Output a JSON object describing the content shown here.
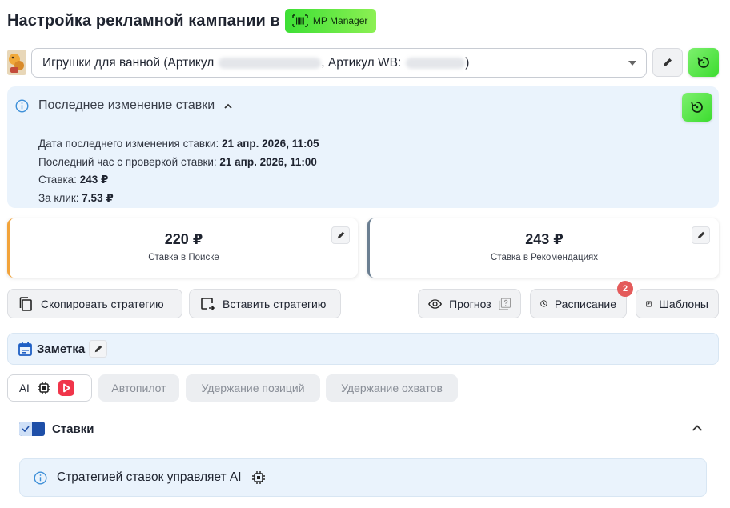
{
  "header": {
    "title": "Настройка рекламной кампании в",
    "brand_label": "MP Manager",
    "brand_color": "#3ddf35"
  },
  "product": {
    "name_prefix": "Игрушки для ванной (Артикул",
    "article_wb_label": ", Артикул WB:",
    "suffix": ")"
  },
  "last_change": {
    "title": "Последнее изменение ставки",
    "rows": [
      {
        "label": "Дата последнего изменения ставки: ",
        "value": "21 апр. 2026, 11:05"
      },
      {
        "label": "Последний час с проверкой ставки: ",
        "value": "21 апр. 2026, 11:00"
      },
      {
        "label": "Ставка: ",
        "value": "243 ₽"
      },
      {
        "label": "За клик: ",
        "value": "7.53 ₽"
      }
    ]
  },
  "bids": {
    "search": {
      "amount": "220 ₽",
      "caption": "Ставка в Поиске",
      "accent": "#f2a33a"
    },
    "recommendations": {
      "amount": "243 ₽",
      "caption": "Ставка в Рекомендациях",
      "accent": "#6b7f92"
    }
  },
  "actions": {
    "copy": "Скопировать стратегию",
    "paste": "Вставить стратегию",
    "forecast": "Прогноз",
    "schedule": "Расписание",
    "schedule_badge": "2",
    "templates": "Шаблоны"
  },
  "note": {
    "label": "Заметка"
  },
  "modes": {
    "ai": "AI",
    "autopilot": "Автопилот",
    "hold_positions": "Удержание позиций",
    "hold_reach": "Удержание охватов"
  },
  "bids_section": {
    "title": "Ставки",
    "ai_message": "Стратегией ставок управляет AI"
  }
}
